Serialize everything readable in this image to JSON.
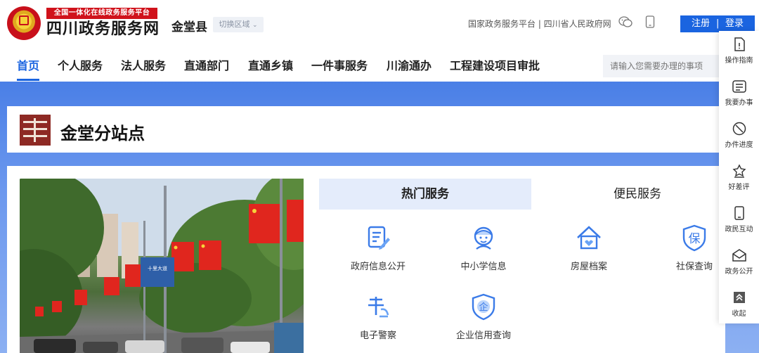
{
  "header": {
    "badge": "全国一体化在线政务服务平台",
    "site_name": "四川政务服务网",
    "county": "金堂县",
    "region_switch": "切换区域",
    "top_links": "国家政务服务平台 | 四川省人民政府网",
    "register": "注册",
    "divider": "|",
    "login": "登录"
  },
  "nav": {
    "items": [
      "首页",
      "个人服务",
      "法人服务",
      "直通部门",
      "直通乡镇",
      "一件事服务",
      "川渝通办",
      "工程建设项目审批"
    ],
    "active_index": 0,
    "search_placeholder": "请输入您需要办理的事项"
  },
  "banner": {
    "title": "金堂分站点"
  },
  "tabs": {
    "hot": "热门服务",
    "convenience": "便民服务"
  },
  "services": [
    {
      "label": "政府信息公开",
      "icon": "document-edit-icon"
    },
    {
      "label": "中小学信息",
      "icon": "student-icon"
    },
    {
      "label": "房屋档案",
      "icon": "house-icon"
    },
    {
      "label": "社保查询",
      "icon": "shield-bao-icon"
    },
    {
      "label": "电子警察",
      "icon": "traffic-police-icon"
    },
    {
      "label": "企业信用查询",
      "icon": "enterprise-shield-icon"
    }
  ],
  "photo_sign": "十里大道",
  "sidebar": {
    "items": [
      {
        "label": "操作指南",
        "icon": "guide-icon"
      },
      {
        "label": "我要办事",
        "icon": "apply-icon"
      },
      {
        "label": "办件进度",
        "icon": "progress-icon"
      },
      {
        "label": "好差评",
        "icon": "rating-icon"
      },
      {
        "label": "政民互动",
        "icon": "mobile-interaction-icon"
      },
      {
        "label": "政务公开",
        "icon": "mail-open-icon"
      },
      {
        "label": "收起",
        "icon": "collapse-icon"
      }
    ]
  },
  "colors": {
    "primary": "#1a64e0",
    "badge_red": "#d0121b",
    "tab_active_bg": "#e4ecfb",
    "banner_bg": "#6c98ee"
  }
}
